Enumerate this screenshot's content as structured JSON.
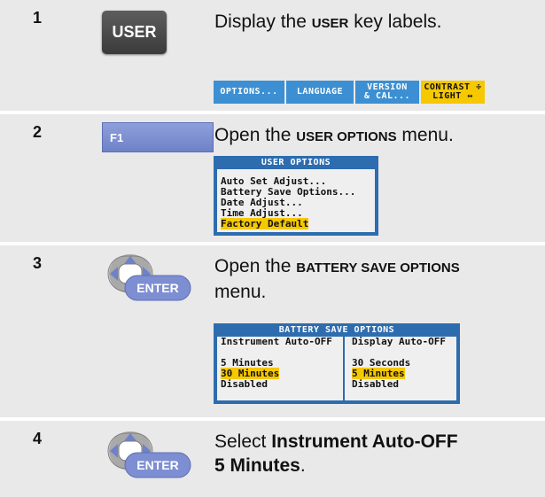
{
  "steps": [
    {
      "number": "1",
      "key_label": "USER",
      "instruction": {
        "pre": "Display the ",
        "bold": "USER",
        "post": " key labels."
      },
      "softkeys": [
        "OPTIONS...",
        "LANGUAGE",
        "VERSION & CAL...",
        "CONTRAST ÷ LIGHT ↔"
      ]
    },
    {
      "number": "2",
      "key_label": "F1",
      "instruction": {
        "pre": "Open the ",
        "bold": "USER OPTIONS",
        "post": " menu."
      },
      "screen": {
        "title": "USER OPTIONS",
        "items": [
          "Auto Set Adjust...",
          "Battery Save Options...",
          "Date Adjust...",
          "Time Adjust..."
        ],
        "highlighted_item": "Factory Default"
      }
    },
    {
      "number": "3",
      "key_label": "ENTER",
      "instruction": {
        "pre": "Open the ",
        "bold": "BATTERY SAVE OPTIONS",
        "post": "menu."
      },
      "screen": {
        "title": "BATTERY SAVE OPTIONS",
        "left_heading": "Instrument Auto-OFF",
        "right_heading": "Display Auto-OFF",
        "left_options": [
          "5 Minutes",
          "30 Minutes",
          "Disabled"
        ],
        "right_options": [
          "30 Seconds",
          "5 Minutes",
          "Disabled"
        ]
      }
    },
    {
      "number": "4",
      "key_label": "ENTER",
      "instruction": {
        "pre": "Select ",
        "bold": "Instrument Auto-OFF",
        "bold2": "5 Minutes",
        "post": "."
      }
    }
  ],
  "colors": {
    "step_bg": "#e9e9e9",
    "softkey_blue": "#3c8fd2",
    "softkey_active": "#f6c800",
    "screen_frame": "#2d6cae",
    "f1_key": "#7d8fd2"
  },
  "icons": [
    "user-key",
    "f1-key",
    "arrow-pad-enter-icon"
  ]
}
